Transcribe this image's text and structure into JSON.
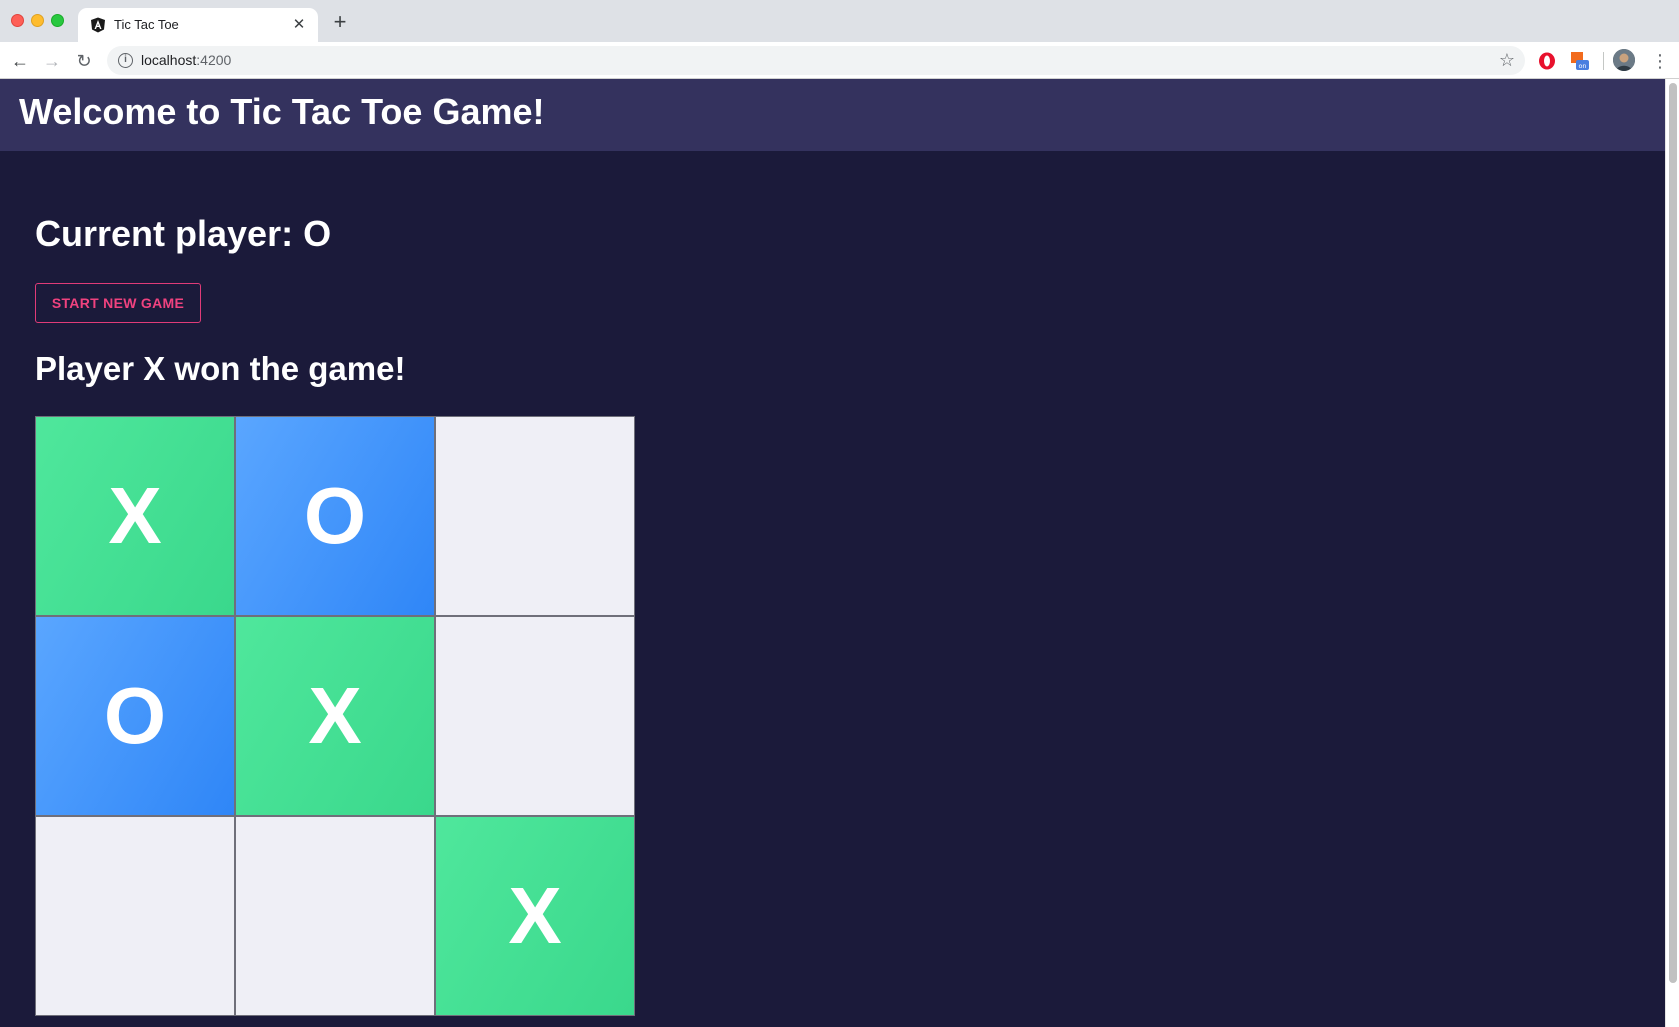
{
  "browser": {
    "tab_title": "Tic Tac Toe",
    "url_host": "localhost",
    "url_port": ":4200"
  },
  "page": {
    "header_title": "Welcome to Tic Tac Toe Game!",
    "current_player_text": "Current player: O",
    "new_game_label": "START NEW GAME",
    "winner_text": "Player X won the game!"
  },
  "board": {
    "cells": [
      "X",
      "O",
      "",
      "O",
      "X",
      "",
      "",
      "",
      "X"
    ]
  },
  "colors": {
    "page_background": "#1b1a3a",
    "header_background": "#34325e",
    "x_cell": "#3ad88c",
    "o_cell": "#2f86f7",
    "empty_cell": "#efeff6",
    "accent_button": "#f0427f"
  }
}
